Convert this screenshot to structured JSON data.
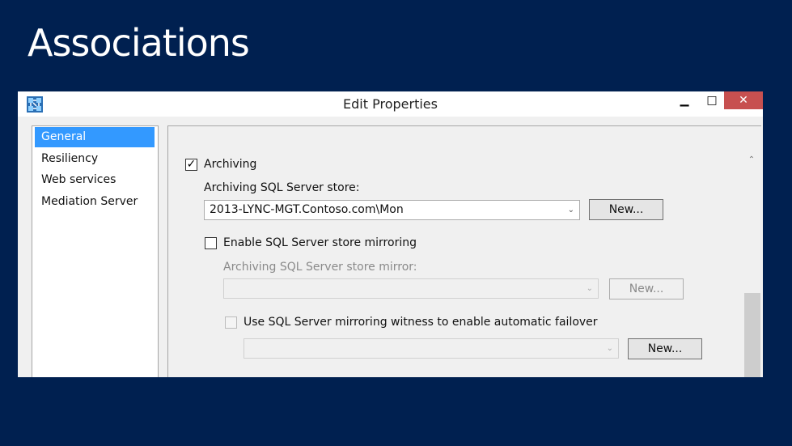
{
  "slide": {
    "title": "Associations"
  },
  "window": {
    "title": "Edit Properties",
    "minimize": "▁",
    "maximize": "□",
    "close": "✕"
  },
  "nav": {
    "items": [
      {
        "label": "General",
        "selected": true
      },
      {
        "label": "Resiliency",
        "selected": false
      },
      {
        "label": "Web services",
        "selected": false
      },
      {
        "label": "Mediation Server",
        "selected": false
      }
    ]
  },
  "content": {
    "archiving": {
      "label": "Archiving",
      "checked": true,
      "mark": "✓"
    },
    "store_label": "Archiving SQL Server store:",
    "store_value": "2013-LYNC-MGT.Contoso.com\\Mon",
    "new_button": "New...",
    "mirroring": {
      "label": "Enable SQL Server store mirroring",
      "checked": false
    },
    "mirror_label": "Archiving SQL Server store mirror:",
    "mirror_value": "",
    "mirror_new_button": "New...",
    "witness": {
      "label": "Use SQL Server mirroring witness to enable automatic failover",
      "checked": false
    },
    "witness_value": "",
    "witness_new_button": "New..."
  },
  "icons": {
    "dropdown": "⌄",
    "scroll_up": "⌃"
  }
}
